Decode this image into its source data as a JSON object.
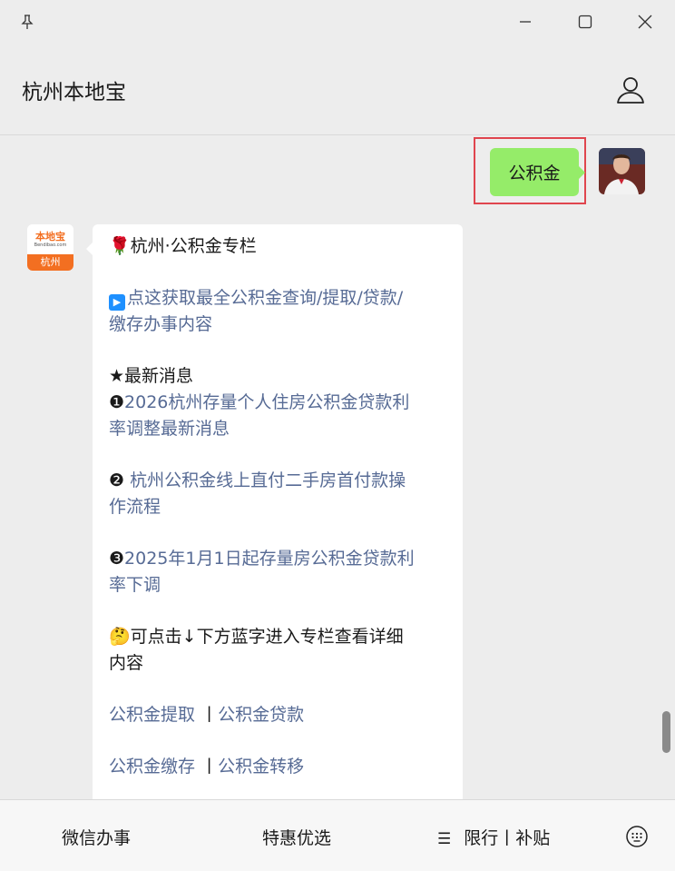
{
  "window": {
    "pin_icon": "pin-icon",
    "minimize_icon": "minimize-icon",
    "maximize_icon": "maximize-icon",
    "close_icon": "close-icon"
  },
  "header": {
    "title": "杭州本地宝",
    "profile_icon": "profile-icon"
  },
  "messages": {
    "user": {
      "text": "公积金"
    },
    "bot": {
      "avatar_text_top": "本地宝",
      "avatar_text_url": "Bendibao.com",
      "avatar_text_city": "杭州",
      "title_emoji": "🌹",
      "title": "杭州·公积金专栏",
      "link_icon": "▶",
      "link_main_line1": "点这获取最全公积金查询/提取/贷款/",
      "link_main_line2": "缴存办事内容",
      "latest_label": "★最新消息",
      "news1_num": "❶",
      "news1_line1": "2026杭州存量个人住房公积金贷款利",
      "news1_line2": "率调整最新消息",
      "news2_num": "❷",
      "news2_line1": " 杭州公积金线上直付二手房首付款操",
      "news2_line2": "作流程",
      "news3_num": "❸",
      "news3_line1": "2025年1月1日起存量房公积金贷款利",
      "news3_line2": "率下调",
      "hint_emoji": "🤔",
      "hint_line1": "可点击↓下方蓝字进入专栏查看详细",
      "hint_line2": "内容",
      "links_row1_a": "公积金提取",
      "links_row1_sep": "丨",
      "links_row1_b": "公积金贷款",
      "links_row2_a": "公积金缴存",
      "links_row2_sep": "丨",
      "links_row2_b": "公积金转移"
    }
  },
  "bottom_menu": {
    "item1": "微信办事",
    "item2": "特惠优选",
    "item3_icon": "☰",
    "item3": "限行丨补贴",
    "keyboard_icon": "keyboard-icon"
  },
  "colors": {
    "user_bubble": "#95ec69",
    "highlight_frame": "#e0454e",
    "link": "#576b95",
    "brand_orange": "#f36f21"
  }
}
